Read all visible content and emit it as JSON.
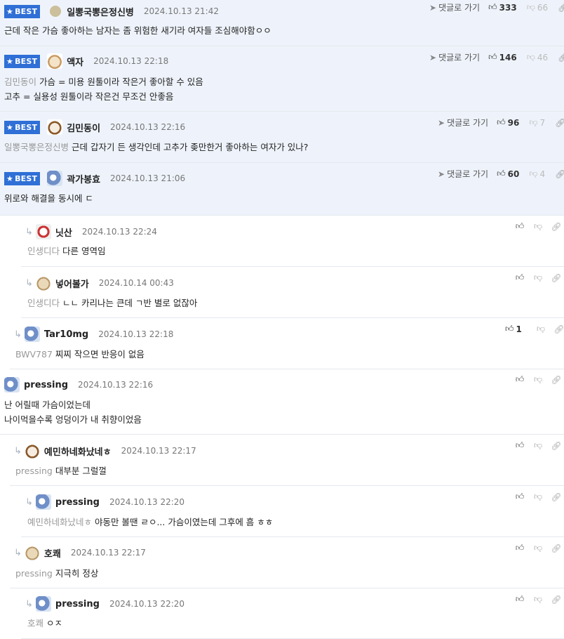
{
  "ui": {
    "best_label": "BEST",
    "goto_label": "댓글로 가기"
  },
  "comments": [
    {
      "best": true,
      "avatar": "blank",
      "nick": "일뽕국뽕은정신병",
      "date": "2024.10.13 21:42",
      "likes": "333",
      "dislikes": "66",
      "lines": [
        {
          "mention": "",
          "text": "근데 작은 가슴 좋아하는 남자는 좀 위험한 새기라 여자들 조심해야함ㅇㅇ"
        }
      ]
    },
    {
      "best": true,
      "avatar": "dog",
      "nick": "액자",
      "date": "2024.10.13 22:18",
      "likes": "146",
      "dislikes": "46",
      "lines": [
        {
          "mention": "김민동이",
          "text": "가슴 = 미용 원툴이라 작은거 좋아할 수 있음"
        },
        {
          "mention": "",
          "text": "고추 = 실용성 원툴이라 작은건 무조건 안좋음"
        }
      ]
    },
    {
      "best": true,
      "avatar": "dog2",
      "nick": "김민동이",
      "date": "2024.10.13 22:16",
      "likes": "96",
      "dislikes": "7",
      "lines": [
        {
          "mention": "일뽕국뽕은정신병",
          "text": "근데 갑자기 든 생각인데 고추가 좆만한거 좋아하는 여자가 있나?"
        }
      ]
    },
    {
      "best": true,
      "avatar": "owl",
      "nick": "곽가봉효",
      "date": "2024.10.13 21:06",
      "likes": "60",
      "dislikes": "4",
      "lines": [
        {
          "mention": "",
          "text": "위로와 해결을 동시에 ㄷ"
        }
      ]
    },
    {
      "avatar": "face",
      "nick": "닛산",
      "date": "2024.10.13 22:24",
      "likes": "",
      "lines": [
        {
          "mention": "인생디다",
          "text": "다른 영역임"
        }
      ]
    },
    {
      "avatar": "bear",
      "nick": "넣어볼가",
      "date": "2024.10.14 00:43",
      "likes": "",
      "lines": [
        {
          "mention": "인생디다",
          "text": "ㄴㄴ 카리나는 큰데 ㄱ반 별로 없잖아"
        }
      ]
    },
    {
      "avatar": "owl",
      "nick": "Tar10mg",
      "date": "2024.10.13 22:18",
      "likes": "1",
      "lines": [
        {
          "mention": "BWV787",
          "text": "찌찌 작으면 반응이 없음"
        }
      ]
    },
    {
      "avatar": "owl",
      "nick": "pressing",
      "date": "2024.10.13 22:16",
      "likes": "",
      "lines": [
        {
          "mention": "",
          "text": "난 어릴때 가슴이었는데"
        },
        {
          "mention": "",
          "text": "나이먹을수록 엉덩이가 내 취향이었음"
        }
      ]
    },
    {
      "avatar": "dog2",
      "nick": "예민하네화났네ㅎ",
      "date": "2024.10.13 22:17",
      "likes": "",
      "lines": [
        {
          "mention": "pressing",
          "text": "대부분 그럴껄"
        }
      ]
    },
    {
      "avatar": "owl",
      "nick": "pressing",
      "date": "2024.10.13 22:20",
      "likes": "",
      "lines": [
        {
          "mention": "예민하네화났네ㅎ",
          "text": "야동만 볼땐 ㄹㅇ... 가슴이였는데 그후에 흠 ㅎㅎ"
        }
      ]
    },
    {
      "avatar": "bear",
      "nick": "호쾌",
      "date": "2024.10.13 22:17",
      "likes": "",
      "lines": [
        {
          "mention": "pressing",
          "text": "지극히 정상"
        }
      ]
    },
    {
      "avatar": "owl",
      "nick": "pressing",
      "date": "2024.10.13 22:20",
      "likes": "",
      "lines": [
        {
          "mention": "호쾌",
          "text": "ㅇㅈ"
        }
      ]
    }
  ]
}
